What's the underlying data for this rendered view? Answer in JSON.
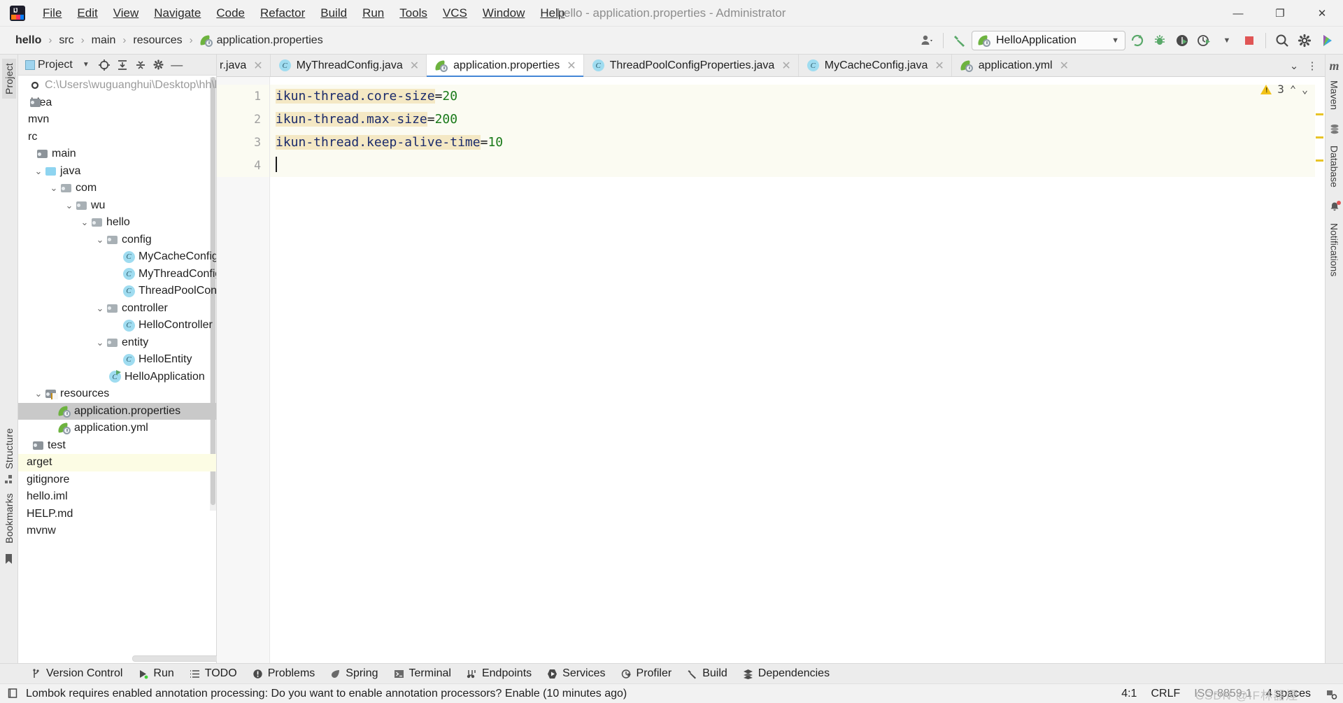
{
  "window": {
    "title": "hello - application.properties - Administrator",
    "menu": [
      "File",
      "Edit",
      "View",
      "Navigate",
      "Code",
      "Refactor",
      "Build",
      "Run",
      "Tools",
      "VCS",
      "Window",
      "Help"
    ],
    "controls": {
      "minimize": "—",
      "maximize": "❐",
      "close": "✕"
    }
  },
  "navbar": {
    "breadcrumbs": [
      "hello",
      "src",
      "main",
      "resources",
      "application.properties"
    ],
    "separator": "›",
    "run_config": "HelloApplication",
    "icons": {
      "profile": "profile-icon",
      "build_hammer": "build-icon",
      "run": "run-icon",
      "debug": "debug-icon",
      "run_coverage": "run-with-coverage-icon",
      "profiler": "profiler-icon",
      "stop": "stop-icon",
      "search": "search-everywhere-icon",
      "settings": "settings-icon",
      "updates": "updates-icon"
    }
  },
  "left_rail": {
    "top": "Project",
    "bookmarks": "Bookmarks",
    "structure": "Structure"
  },
  "right_rail": {
    "maven": "Maven",
    "database": "Database",
    "notifications": "Notifications",
    "maven_glyph": "m"
  },
  "project_panel": {
    "title": "Project",
    "toolbar_icons": [
      "select-opened-file-icon",
      "expand-all-icon",
      "collapse-all-icon",
      "settings-icon",
      "hide-icon"
    ],
    "tree": [
      {
        "label": "C:\\Users\\wuguanghui\\Desktop\\hh\\hel",
        "indent": 0,
        "type": "path",
        "arrow": "",
        "icon": "module-icon"
      },
      {
        "label": "idea",
        "indent": 0,
        "type": "folder-dark",
        "arrow": "",
        "icon": "folder-icon"
      },
      {
        "label": "mvn",
        "indent": 0,
        "type": "none",
        "arrow": "",
        "icon": ""
      },
      {
        "label": "rc",
        "indent": 0,
        "type": "none",
        "arrow": "",
        "icon": ""
      },
      {
        "label": "main",
        "indent": 0,
        "type": "folder-dark",
        "arrow": "",
        "icon": "folder-icon"
      },
      {
        "label": "java",
        "indent": 1,
        "type": "folder-blue",
        "arrow": "⌄",
        "icon": "source-folder-icon"
      },
      {
        "label": "com",
        "indent": 2,
        "type": "folder-pkg",
        "arrow": "⌄",
        "icon": "package-icon"
      },
      {
        "label": "wu",
        "indent": 3,
        "type": "folder-pkg",
        "arrow": "⌄",
        "icon": "package-icon"
      },
      {
        "label": "hello",
        "indent": 4,
        "type": "folder-pkg",
        "arrow": "⌄",
        "icon": "package-icon"
      },
      {
        "label": "config",
        "indent": 5,
        "type": "folder-pkg",
        "arrow": "⌄",
        "icon": "package-icon"
      },
      {
        "label": "MyCacheConfig",
        "indent": 6,
        "type": "class",
        "arrow": "",
        "icon": "java-class-icon"
      },
      {
        "label": "MyThreadConfig",
        "indent": 6,
        "type": "class",
        "arrow": "",
        "icon": "java-class-icon"
      },
      {
        "label": "ThreadPoolConfigP",
        "indent": 6,
        "type": "class",
        "arrow": "",
        "icon": "java-class-icon"
      },
      {
        "label": "controller",
        "indent": 5,
        "type": "folder-pkg",
        "arrow": "⌄",
        "icon": "package-icon"
      },
      {
        "label": "HelloController",
        "indent": 6,
        "type": "class",
        "arrow": "",
        "icon": "java-class-icon"
      },
      {
        "label": "entity",
        "indent": 5,
        "type": "folder-pkg",
        "arrow": "⌄",
        "icon": "package-icon"
      },
      {
        "label": "HelloEntity",
        "indent": 6,
        "type": "class",
        "arrow": "",
        "icon": "java-class-icon"
      },
      {
        "label": "HelloApplication",
        "indent": 5,
        "type": "spring-class",
        "arrow": "",
        "icon": "spring-boot-class-icon"
      },
      {
        "label": "resources",
        "indent": 1,
        "type": "folder-res",
        "arrow": "⌄",
        "icon": "resource-folder-icon"
      },
      {
        "label": "application.properties",
        "indent": 2,
        "type": "spring-file",
        "arrow": "",
        "icon": "spring-properties-icon",
        "selected": true
      },
      {
        "label": "application.yml",
        "indent": 2,
        "type": "spring-file",
        "arrow": "",
        "icon": "spring-yaml-icon"
      },
      {
        "label": "test",
        "indent": 0,
        "type": "folder-dark",
        "arrow": "",
        "icon": "folder-icon"
      },
      {
        "label": "arget",
        "indent": 0,
        "type": "none",
        "arrow": "",
        "icon": "",
        "highlight": true
      },
      {
        "label": "gitignore",
        "indent": 0,
        "type": "none",
        "arrow": "",
        "icon": ""
      },
      {
        "label": "hello.iml",
        "indent": 0,
        "type": "none",
        "arrow": "",
        "icon": ""
      },
      {
        "label": "HELP.md",
        "indent": 0,
        "type": "none",
        "arrow": "",
        "icon": ""
      },
      {
        "label": "mvnw",
        "indent": 0,
        "type": "none",
        "arrow": "",
        "icon": ""
      }
    ]
  },
  "editor": {
    "tabs": [
      {
        "label": "r.java",
        "icon": "java-class-icon",
        "active": false,
        "show_icon": false
      },
      {
        "label": "MyThreadConfig.java",
        "icon": "java-class-icon",
        "active": false,
        "show_icon": true
      },
      {
        "label": "application.properties",
        "icon": "spring-properties-icon",
        "active": true,
        "show_icon": true
      },
      {
        "label": "ThreadPoolConfigProperties.java",
        "icon": "java-class-icon",
        "active": false,
        "show_icon": true
      },
      {
        "label": "MyCacheConfig.java",
        "icon": "java-class-icon",
        "active": false,
        "show_icon": true
      },
      {
        "label": "application.yml",
        "icon": "spring-yaml-icon",
        "active": false,
        "show_icon": true
      }
    ],
    "tab_overflow_icon": "chevron-down-icon",
    "tab_menu_icon": "more-vertical-icon",
    "lines": [
      {
        "n": "1",
        "key": "ikun-thread.core-size",
        "eq": "=",
        "value": "20",
        "current": true
      },
      {
        "n": "2",
        "key": "ikun-thread.max-size",
        "eq": "=",
        "value": "200",
        "current": true
      },
      {
        "n": "3",
        "key": "ikun-thread.keep-alive-time",
        "eq": "=",
        "value": "10",
        "current": true
      },
      {
        "n": "4",
        "key": "",
        "eq": "",
        "value": "",
        "current": true
      }
    ],
    "inspections": {
      "count": "3",
      "warning_icon": "warning-triangle-icon",
      "prev": "⌃",
      "next": "⌄"
    }
  },
  "tool_windows": [
    {
      "label": "Version Control",
      "icon": "branch-icon"
    },
    {
      "label": "Run",
      "icon": "run-icon"
    },
    {
      "label": "TODO",
      "icon": "todo-icon"
    },
    {
      "label": "Problems",
      "icon": "problems-icon"
    },
    {
      "label": "Spring",
      "icon": "spring-icon"
    },
    {
      "label": "Terminal",
      "icon": "terminal-icon"
    },
    {
      "label": "Endpoints",
      "icon": "endpoints-icon"
    },
    {
      "label": "Services",
      "icon": "services-icon"
    },
    {
      "label": "Profiler",
      "icon": "profiler-icon"
    },
    {
      "label": "Build",
      "icon": "build-icon"
    },
    {
      "label": "Dependencies",
      "icon": "dependencies-icon"
    }
  ],
  "status_bar": {
    "message": "Lombok requires enabled annotation processing: Do you want to enable annotation processors? Enable (10 minutes ago)",
    "message_icon": "event-log-icon",
    "caret_position": "4:1",
    "line_separator": "CRLF",
    "encoding": "ISO-8859-1",
    "indent": "4 spaces",
    "watermark": "CSDN @IF林器煙"
  }
}
